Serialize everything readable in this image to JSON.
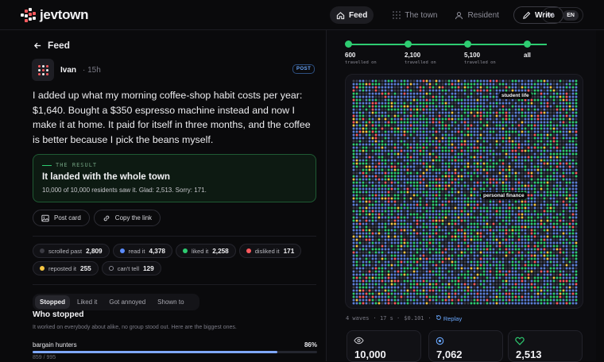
{
  "app": {
    "brand": "jevtown",
    "brand_colors": [
      "#ff5a5f",
      "#f0f0f0"
    ]
  },
  "nav": {
    "feed": "Feed",
    "the_town": "The town",
    "resident": "Resident",
    "write": "Write"
  },
  "lang": {
    "ua": "UA",
    "en": "EN",
    "selected": "EN"
  },
  "post": {
    "back_label": "Feed",
    "author": "Ivan",
    "time": "· 15h",
    "tag": "POST",
    "text": "I added up what my morning coffee-shop habit costs per year: $1,640. Bought a $350 espresso machine instead and now I make it at home. It paid for itself in three months, and the coffee is better because I pick the beans myself."
  },
  "result": {
    "kicker": "THE RESULT",
    "headline": "It landed with the whole town",
    "summary": "10,000 of 10,000 residents saw it. Glad: 2,513. Sorry: 171."
  },
  "actions": {
    "post_card": "Post card",
    "copy_link": "Copy the link"
  },
  "reactions": [
    {
      "label": "scrolled past",
      "value": "2,809",
      "color": "#3a3a42"
    },
    {
      "label": "read it",
      "value": "4,378",
      "color": "#5b8cff"
    },
    {
      "label": "liked it",
      "value": "2,258",
      "color": "#2ecc71"
    },
    {
      "label": "disliked it",
      "value": "171",
      "color": "#ff5a5f"
    },
    {
      "label": "reposted it",
      "value": "255",
      "color": "#f5c542"
    },
    {
      "label": "can't tell",
      "value": "129",
      "color": "#0a0a0c"
    }
  ],
  "tabs": [
    "Stopped",
    "Liked it",
    "Got annoyed",
    "Shown to"
  ],
  "who": {
    "title": "Who stopped",
    "subtitle": "It worked on everybody about alike, no group stood out. Here are the biggest ones.",
    "groups": [
      {
        "name": "bargain hunters",
        "percent": "86%",
        "fraction": 0.86,
        "count": "859 / 995"
      }
    ]
  },
  "timeline": [
    {
      "value": "600",
      "label": "travelled on"
    },
    {
      "value": "2,100",
      "label": "travelled on"
    },
    {
      "value": "5,100",
      "label": "travelled on"
    },
    {
      "value": "all",
      "label": ""
    }
  ],
  "map": {
    "tags": [
      "student life",
      "personal finance"
    ],
    "colors": {
      "blue": "#5b7fd6",
      "green": "#2ecc71",
      "red": "#ff5a5f",
      "yellow": "#f5c542",
      "grey": "#3d4250"
    }
  },
  "run_meta": {
    "waves": "4 waves",
    "time": "· 17 s ·",
    "cost": "$0.101",
    "sep": "·",
    "replay": "Replay"
  },
  "cards": [
    {
      "icon": "eye-icon",
      "value": "10,000"
    },
    {
      "icon": "target-icon",
      "value": "7,062"
    },
    {
      "icon": "heart-icon",
      "value": "2,513"
    }
  ]
}
